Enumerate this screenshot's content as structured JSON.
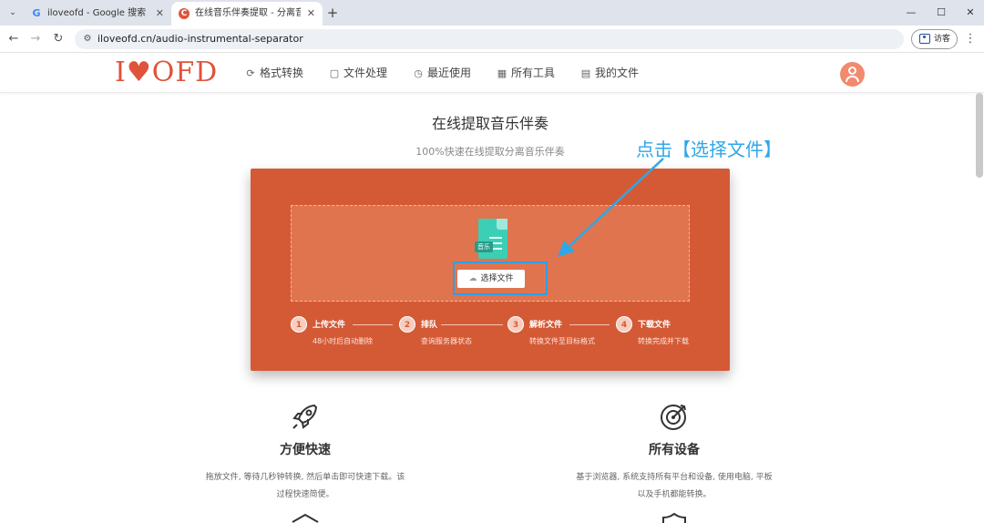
{
  "browser": {
    "tabs": [
      {
        "title": "iloveofd - Google 搜索",
        "favicon": "google-icon",
        "active": false
      },
      {
        "title": "在线音乐伴奏提取 - 分离音频人",
        "favicon": "iloveofd-icon",
        "active": true
      }
    ],
    "url": "iloveofd.cn/audio-instrumental-separator",
    "guest_label": "访客"
  },
  "site": {
    "logo": {
      "left": "I",
      "heart": "♥",
      "right": "OFD"
    },
    "nav": [
      {
        "label": "格式转换",
        "icon": "convert-icon"
      },
      {
        "label": "文件处理",
        "icon": "file-edit-icon"
      },
      {
        "label": "最近使用",
        "icon": "recent-icon"
      },
      {
        "label": "所有工具",
        "icon": "grid-icon"
      },
      {
        "label": "我的文件",
        "icon": "document-icon"
      }
    ]
  },
  "main": {
    "title": "在线提取音乐伴奏",
    "subtitle": "100%快速在线提取分离音乐伴奏",
    "annotation": "点击【选择文件】",
    "upload": {
      "file_badge": "音乐",
      "select_button": "选择文件"
    },
    "steps": [
      {
        "num": "1",
        "label": "上传文件",
        "desc": "48小时后自动删除"
      },
      {
        "num": "2",
        "label": "排队",
        "desc": "查询服务器状态"
      },
      {
        "num": "3",
        "label": "解析文件",
        "desc": "转换文件至目标格式"
      },
      {
        "num": "4",
        "label": "下载文件",
        "desc": "转换完成并下载"
      }
    ],
    "features": [
      {
        "title": "方便快速",
        "desc": "拖放文件, 等待几秒钟转换, 然后单击即可快速下载。该过程快速简便。",
        "icon": "rocket-icon"
      },
      {
        "title": "所有设备",
        "desc": "基于浏览器, 系统支持所有平台和设备, 使用电脑, 平板以及手机都能转换。",
        "icon": "target-icon"
      }
    ]
  },
  "colors": {
    "brand": "#e0533b",
    "card": "#d45a36",
    "drop_zone": "#e0744f",
    "annotation": "#2ea7e8",
    "file_icon": "#3ccfb5"
  }
}
